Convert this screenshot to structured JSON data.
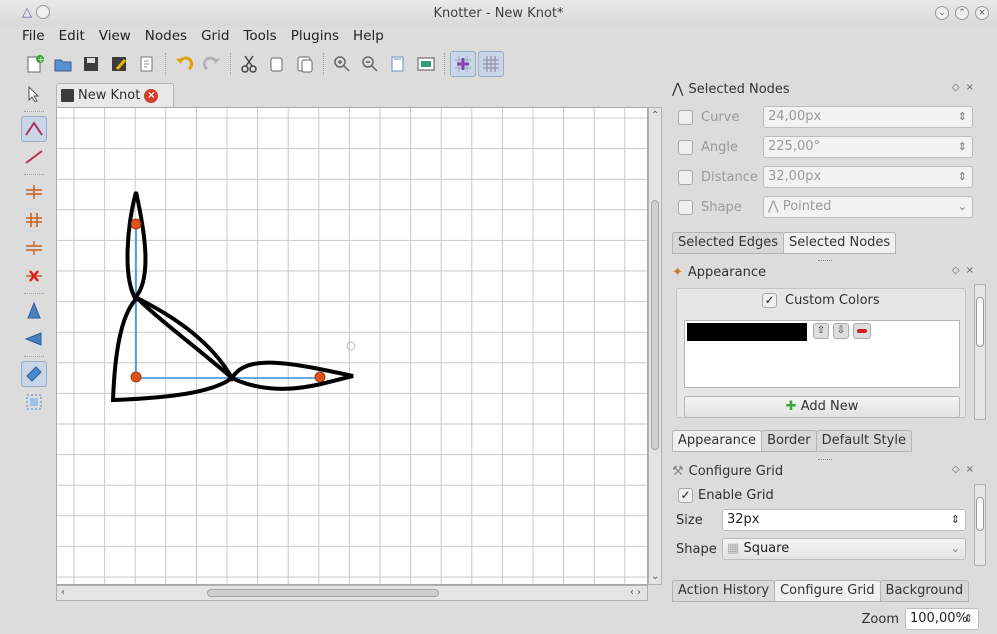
{
  "window": {
    "title": "Knotter - New Knot*"
  },
  "menu": [
    "File",
    "Edit",
    "View",
    "Nodes",
    "Grid",
    "Tools",
    "Plugins",
    "Help"
  ],
  "document_tab": {
    "label": "New Knot"
  },
  "selected_nodes": {
    "title": "Selected Nodes",
    "curve": {
      "label": "Curve",
      "value": "24,00px"
    },
    "angle": {
      "label": "Angle",
      "value": "225,00°"
    },
    "distance": {
      "label": "Distance",
      "value": "32,00px"
    },
    "shape": {
      "label": "Shape",
      "value": "Pointed"
    }
  },
  "tabs_top": [
    "Selected Edges",
    "Selected Nodes"
  ],
  "appearance": {
    "title": "Appearance",
    "custom_colors": "Custom Colors",
    "color": "#000000",
    "add_new": "Add New"
  },
  "tabs_mid": [
    "Appearance",
    "Border",
    "Default Style"
  ],
  "configure_grid": {
    "title": "Configure Grid",
    "enable_grid": "Enable Grid",
    "size_label": "Size",
    "size_value": "32px",
    "shape_label": "Shape",
    "shape_value": "Square"
  },
  "tabs_bottom": [
    "Action History",
    "Configure Grid",
    "Background"
  ],
  "zoom": {
    "label": "Zoom",
    "value": "100,00%"
  },
  "colors": {
    "accent": "#3a8fd6",
    "node": "#e0521c",
    "knot": "#000000"
  }
}
